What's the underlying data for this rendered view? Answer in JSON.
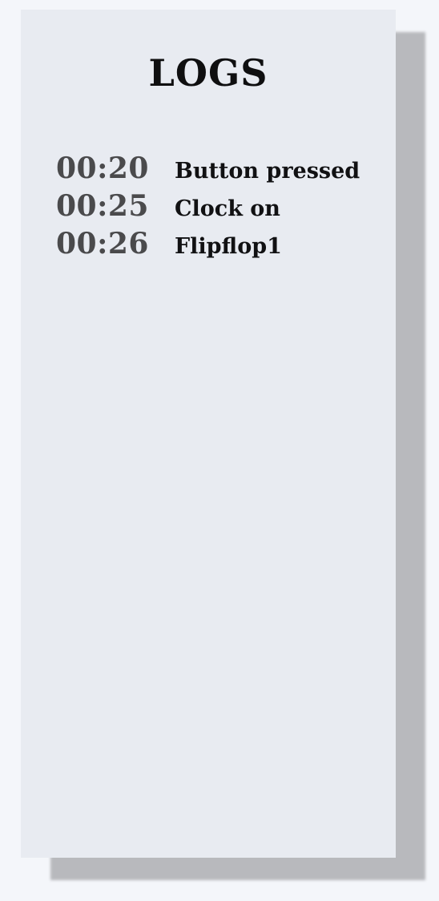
{
  "logs_panel": {
    "title": "LOGS",
    "entries": [
      {
        "time": "00:20",
        "message": "Button pressed"
      },
      {
        "time": "00:25",
        "message": "Clock on"
      },
      {
        "time": "00:26",
        "message": "Flipflop1"
      }
    ]
  }
}
